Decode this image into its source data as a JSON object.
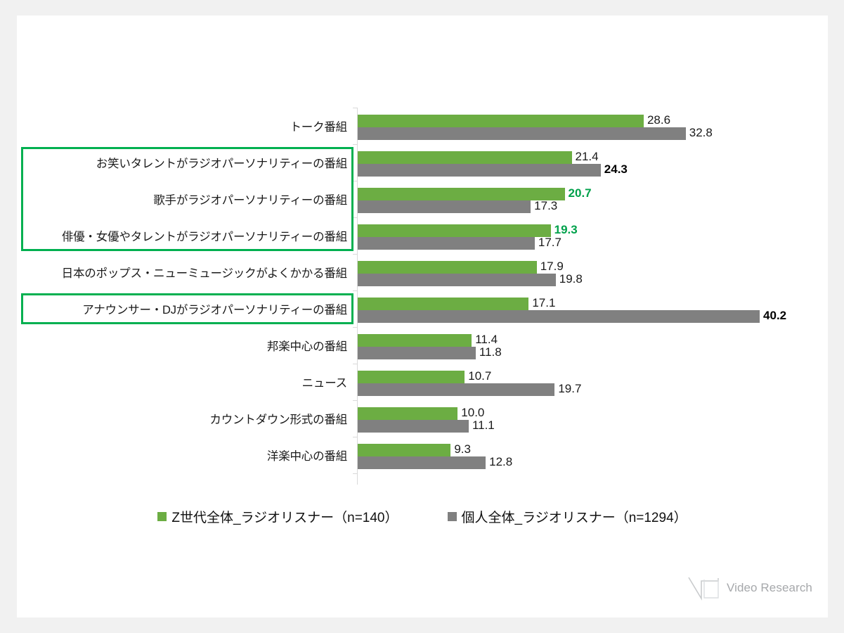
{
  "chart_data": {
    "type": "bar",
    "orientation": "horizontal",
    "grid": false,
    "legend_position": "bottom",
    "title": "",
    "xlabel": "",
    "ylabel": "",
    "xlim": [
      0,
      40.2
    ],
    "categories": [
      "トーク番組",
      "お笑いタレントがラジオパーソナリティーの番組",
      "歌手がラジオパーソナリティーの番組",
      "俳優・女優やタレントがラジオパーソナリティーの番組",
      "日本のポップス・ニューミュージックがよくかかる番組",
      "アナウンサー・DJがラジオパーソナリティーの番組",
      "邦楽中心の番組",
      "ニュース",
      "カウントダウン形式の番組",
      "洋楽中心の番組"
    ],
    "series": [
      {
        "name": "Z世代全体_ラジオリスナー（n=140）",
        "color": "#6cad43",
        "values": [
          28.6,
          21.4,
          20.7,
          19.3,
          17.9,
          17.1,
          11.4,
          10.7,
          10.0,
          9.3
        ],
        "labels": [
          "28.6",
          "21.4",
          "20.7",
          "19.3",
          "17.9",
          "17.1",
          "11.4",
          "10.7",
          "10.0",
          "9.3"
        ],
        "emphasis": [
          "none",
          "none",
          "green",
          "green",
          "none",
          "none",
          "none",
          "none",
          "none",
          "none"
        ]
      },
      {
        "name": "個人全体_ラジオリスナー（n=1294）",
        "color": "#808080",
        "values": [
          32.8,
          24.3,
          17.3,
          17.7,
          19.8,
          40.2,
          11.8,
          19.7,
          11.1,
          12.8
        ],
        "labels": [
          "32.8",
          "24.3",
          "17.3",
          "17.7",
          "19.8",
          "40.2",
          "11.8",
          "19.7",
          "11.1",
          "12.8"
        ],
        "emphasis": [
          "none",
          "black",
          "none",
          "none",
          "none",
          "black",
          "none",
          "none",
          "none",
          "none"
        ]
      }
    ],
    "highlight_boxes": [
      {
        "color": "#00b050",
        "categories": [
          "お笑いタレントがラジオパーソナリティーの番組",
          "歌手がラジオパーソナリティーの番組",
          "俳優・女優やタレントがラジオパーソナリティーの番組"
        ]
      },
      {
        "color": "#00b050",
        "categories": [
          "アナウンサー・DJがラジオパーソナリティーの番組"
        ]
      }
    ]
  },
  "legend": {
    "items": [
      {
        "label": "Z世代全体_ラジオリスナー（n=140）",
        "color": "#6cad43"
      },
      {
        "label": "個人全体_ラジオリスナー（n=1294）",
        "color": "#808080"
      }
    ]
  },
  "logo": {
    "text": "Video Research",
    "color": "#a6a8ab"
  }
}
